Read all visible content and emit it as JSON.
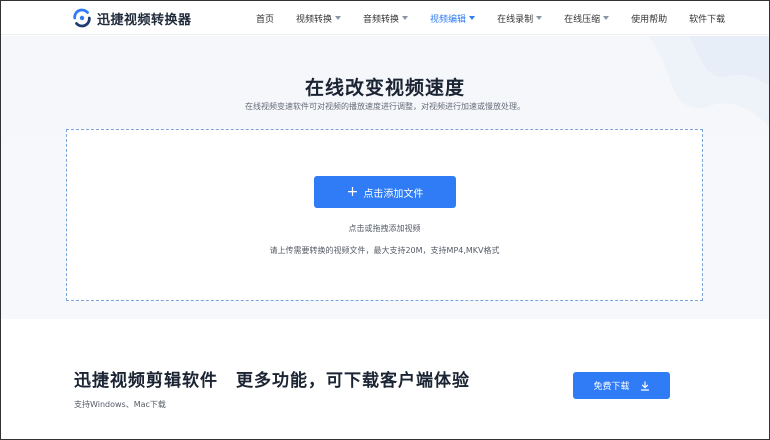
{
  "header": {
    "brand": "迅捷视频转换器",
    "nav": [
      {
        "label": "首页",
        "has_caret": false,
        "active": false
      },
      {
        "label": "视频转换",
        "has_caret": true,
        "active": false
      },
      {
        "label": "音频转换",
        "has_caret": true,
        "active": false
      },
      {
        "label": "视频编辑",
        "has_caret": true,
        "active": true
      },
      {
        "label": "在线录制",
        "has_caret": true,
        "active": false
      },
      {
        "label": "在线压缩",
        "has_caret": true,
        "active": false
      },
      {
        "label": "使用帮助",
        "has_caret": false,
        "active": false
      },
      {
        "label": "软件下载",
        "has_caret": false,
        "active": false
      }
    ]
  },
  "hero": {
    "title": "在线改变视频速度",
    "subtitle": "在线视频变速软件可对视频的播放速度进行调整，对视频进行加速或慢放处理。"
  },
  "upload": {
    "button_label": "点击添加文件",
    "hint_drag": "点击或拖拽添加视频",
    "hint_formats": "请上传需要转换的视频文件，最大支持20M，支持MP4,MKV格式"
  },
  "promo": {
    "title_part1": "迅捷视频剪辑软件",
    "title_part2": "更多功能，可下载客户端体验",
    "subtitle": "支持Windows、Mac下载",
    "download_label": "免费下载"
  },
  "colors": {
    "accent": "#2f7cf6",
    "active_nav": "#2f7cf6",
    "dashed_border": "#7aa3d8"
  },
  "icons": {
    "brand": "swirl-logo-icon",
    "add": "plus-icon",
    "download": "download-arrow-icon"
  }
}
